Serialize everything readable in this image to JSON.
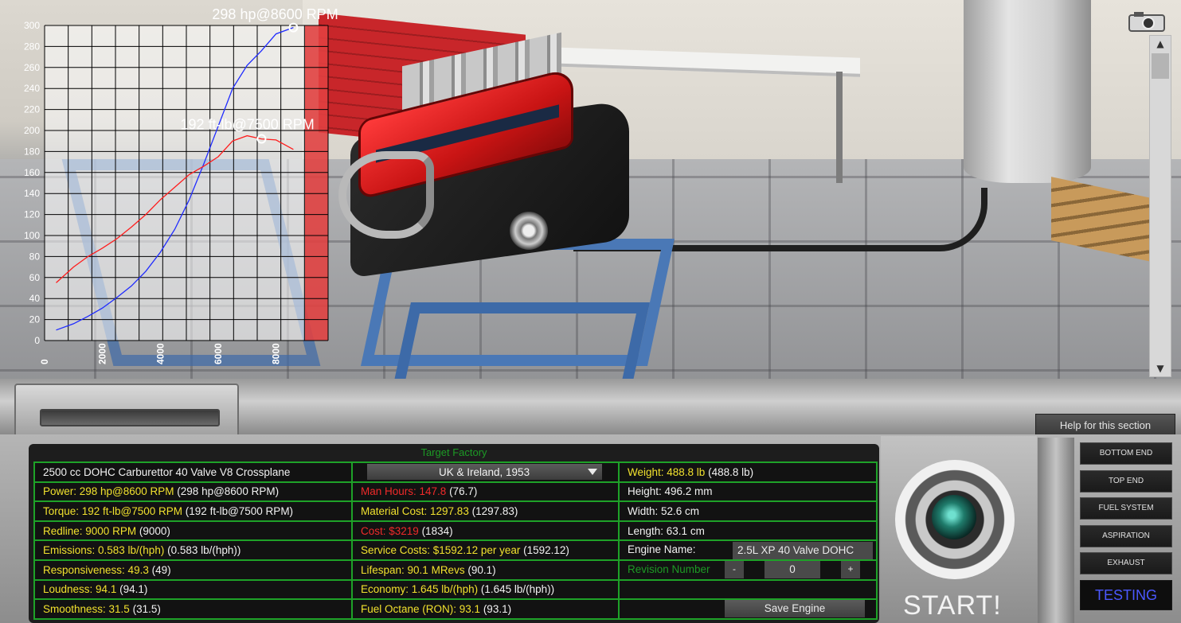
{
  "chart_data": {
    "type": "line",
    "title": "",
    "xlabel": "",
    "ylabel": "",
    "xlim": [
      0,
      9800
    ],
    "ylim": [
      0,
      300
    ],
    "x_ticks": [
      "0",
      "2000",
      "4000",
      "6000",
      "8000"
    ],
    "y_ticks": [
      "0",
      "20",
      "40",
      "60",
      "80",
      "100",
      "120",
      "140",
      "160",
      "180",
      "200",
      "220",
      "240",
      "260",
      "280",
      "300"
    ],
    "redline_from": 9000,
    "grid": true,
    "series": [
      {
        "color": "#1f2bff",
        "x": [
          400,
          1000,
          1500,
          2000,
          2500,
          3000,
          3500,
          4000,
          4500,
          5000,
          5500,
          6000,
          6500,
          7000,
          7500,
          8000,
          8600
        ],
        "y": [
          10,
          16,
          23,
          31,
          41,
          52,
          66,
          84,
          106,
          134,
          168,
          204,
          240,
          262,
          276,
          292,
          298
        ]
      },
      {
        "color": "#ff1d1d",
        "x": [
          400,
          1000,
          1500,
          2000,
          2500,
          3000,
          3500,
          4000,
          4500,
          5000,
          5500,
          6000,
          6500,
          7000,
          7500,
          8000,
          8600
        ],
        "y": [
          55,
          70,
          80,
          88,
          97,
          108,
          120,
          134,
          146,
          158,
          166,
          175,
          190,
          195,
          192,
          191,
          182
        ]
      }
    ],
    "annotations": [
      {
        "text": "298 hp@8600 RPM",
        "x": 8600,
        "y": 298
      },
      {
        "text": "192 ft-lb@7500 RPM",
        "x": 7500,
        "y": 192
      }
    ]
  },
  "panel": {
    "title": "Target Factory",
    "help_label": "Help for this section",
    "start_label": "START!"
  },
  "stats": {
    "engine_desc": "2500 cc DOHC Carburettor 40 Valve V8 Crossplane",
    "market": "UK & Ireland, 1953",
    "weight_label": "Weight: 488.8 lb",
    "weight_raw": " (488.8 lb)",
    "power_label": "Power: 298 hp@8600 RPM",
    "power_raw": " (298 hp@8600 RPM)",
    "man_hours_label": "Man Hours: 147.8",
    "man_hours_raw": " (76.7)",
    "height": "Height: 496.2 mm",
    "torque_label": "Torque: 192 ft-lb@7500 RPM",
    "torque_raw": " (192 ft-lb@7500 RPM)",
    "material_label": "Material Cost: 1297.83",
    "material_raw": " (1297.83)",
    "width": "Width: 52.6 cm",
    "redline_label": "Redline: 9000 RPM",
    "redline_raw": " (9000)",
    "cost_label": "Cost: $3219",
    "cost_raw": " (1834)",
    "length": "Length: 63.1 cm",
    "emissions_label": "Emissions: 0.583 lb/(hph)",
    "emissions_raw": " (0.583 lb/(hph))",
    "service_label": "Service Costs: $1592.12 per year",
    "service_raw": " (1592.12)",
    "engine_name_label": "Engine Name:",
    "engine_name_value": "2.5L XP 40 Valve DOHC",
    "responsiveness_label": "Responsiveness: 49.3",
    "responsiveness_raw": " (49)",
    "lifespan_label": "Lifespan: 90.1 MRevs",
    "lifespan_raw": " (90.1)",
    "revision_label": "Revision Number",
    "revision_minus": "-",
    "revision_value": "0",
    "revision_plus": "+",
    "loudness_label": "Loudness: 94.1",
    "loudness_raw": " (94.1)",
    "economy_label": "Economy: 1.645 lb/(hph)",
    "economy_raw": " (1.645 lb/(hph))",
    "smoothness_label": "Smoothness: 31.5",
    "smoothness_raw": " (31.5)",
    "octane_label": "Fuel Octane (RON): 93.1",
    "octane_raw": " (93.1)",
    "save_label": "Save Engine"
  },
  "side_menu": [
    "BOTTOM END",
    "TOP END",
    "FUEL SYSTEM",
    "ASPIRATION",
    "EXHAUST",
    "TESTING"
  ],
  "icons": {
    "camera": "camera-icon",
    "scroll_up": "chevron-up-icon",
    "scroll_down": "chevron-down-icon",
    "dropdown": "chevron-down-icon"
  }
}
